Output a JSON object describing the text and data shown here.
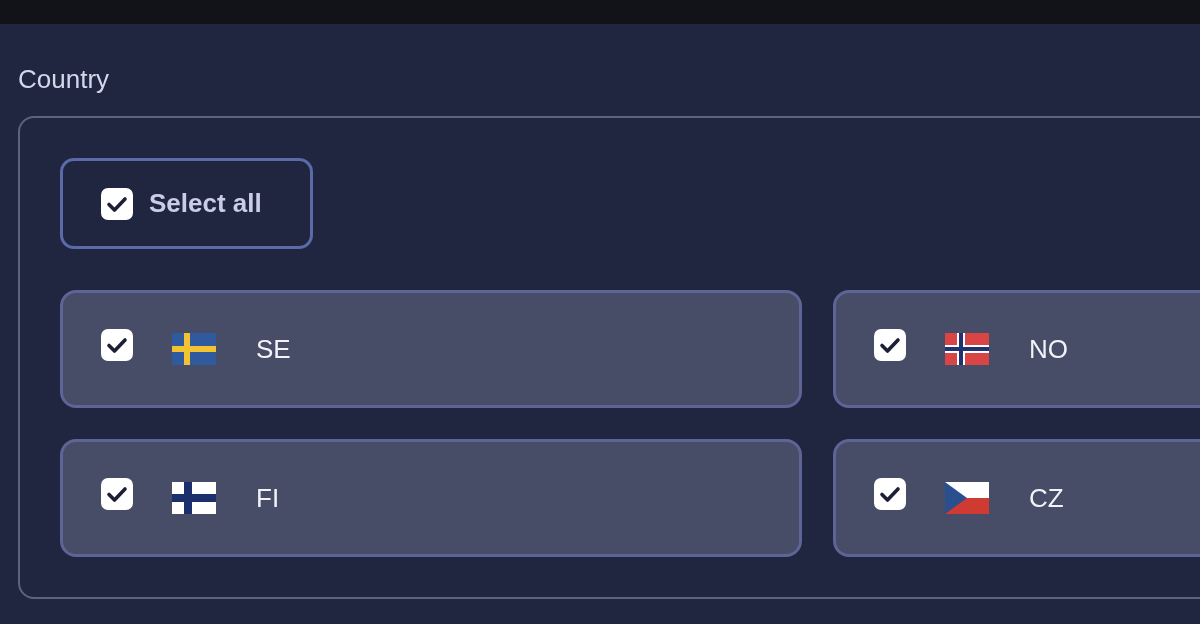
{
  "field": {
    "label": "Country"
  },
  "select_all": {
    "label": "Select all",
    "checked": true
  },
  "countries": [
    {
      "code": "SE",
      "kind": "se",
      "checked": true
    },
    {
      "code": "NO",
      "kind": "no",
      "checked": true
    },
    {
      "code": "FI",
      "kind": "fi",
      "checked": true
    },
    {
      "code": "CZ",
      "kind": "cz",
      "checked": true
    }
  ]
}
